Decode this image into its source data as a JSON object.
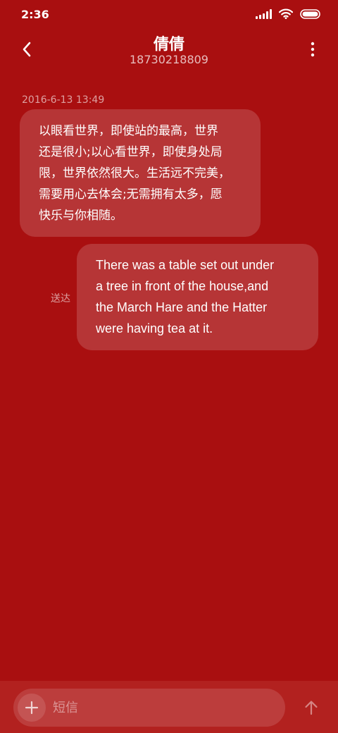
{
  "status_bar": {
    "time": "2:36",
    "icons": [
      "signal-icon",
      "wifi-icon",
      "battery-icon"
    ]
  },
  "header": {
    "contact_name": "倩倩",
    "phone_number": "18730218809",
    "back_icon": "chevron-left-icon",
    "menu_icon": "more-vertical-icon"
  },
  "messages": [
    {
      "direction": "incoming",
      "timestamp": "2016-6-13 13:49",
      "text": "以眼看世界，即使站的最高，世界\n还是很小;以心看世界，即使身处局\n限，世界依然很大。生活远不完美，\n需要用心去体会;无需拥有太多，愿\n快乐与你相随。"
    },
    {
      "direction": "outgoing",
      "status": "送达",
      "text": "There was a table set out under\na tree in front of the house,and\nthe March Hare and the Hatter\nwere having tea at it."
    }
  ],
  "input_bar": {
    "placeholder": "短信",
    "add_icon": "plus-icon",
    "send_icon": "arrow-up-icon"
  },
  "colors": {
    "background": "#a90f10",
    "input_bar": "#b2211f",
    "text": "#ffffff"
  }
}
